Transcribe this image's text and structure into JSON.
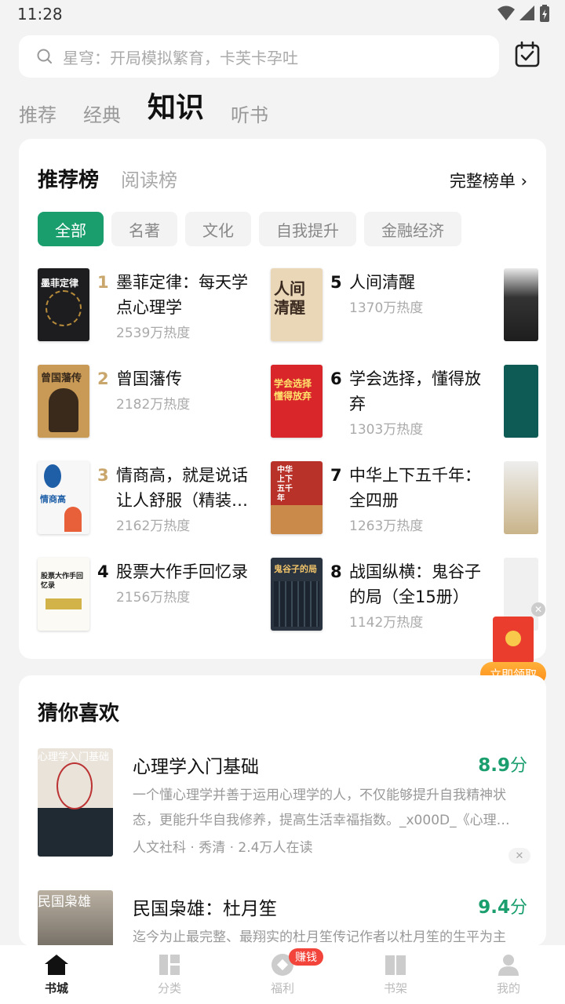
{
  "status": {
    "time": "11:28"
  },
  "search": {
    "placeholder": "星穹：开局模拟繁育，卡芙卡孕吐"
  },
  "tabs": [
    {
      "label": "推荐"
    },
    {
      "label": "经典"
    },
    {
      "label": "知识",
      "active": true
    },
    {
      "label": "听书"
    }
  ],
  "ranking": {
    "title": "推荐榜",
    "alt_title": "阅读榜",
    "full_list_label": "完整榜单",
    "chips": [
      {
        "label": "全部",
        "active": true
      },
      {
        "label": "名著"
      },
      {
        "label": "文化"
      },
      {
        "label": "自我提升"
      },
      {
        "label": "金融经济"
      }
    ],
    "books": [
      {
        "rank": "1",
        "title": "墨菲定律：每天学点心理学",
        "heat": "2539万热度",
        "cover_text": "墨菲定律"
      },
      {
        "rank": "2",
        "title": "曾国藩传",
        "heat": "2182万热度",
        "cover_text": "曾国藩传"
      },
      {
        "rank": "3",
        "title": "情商高，就是说话让人舒服（精装…",
        "heat": "2162万热度",
        "cover_text": "情商高"
      },
      {
        "rank": "4",
        "title": "股票大作手回忆录",
        "heat": "2156万热度",
        "cover_text": "股票大作手回忆录"
      },
      {
        "rank": "5",
        "title": "人间清醒",
        "heat": "1370万热度",
        "cover_text": "人间清醒"
      },
      {
        "rank": "6",
        "title": "学会选择，懂得放弃",
        "heat": "1303万热度",
        "cover_text": "学会选择懂得放弃"
      },
      {
        "rank": "7",
        "title": "中华上下五千年：全四册",
        "heat": "1263万热度",
        "cover_text": "中华上下五千年"
      },
      {
        "rank": "8",
        "title": "战国纵横：鬼谷子的局（全15册）",
        "heat": "1142万热度",
        "cover_text": "鬼谷子的局"
      }
    ]
  },
  "redpacket": {
    "label": "立即领取"
  },
  "guess": {
    "title": "猜你喜欢",
    "items": [
      {
        "name": "心理学入门基础",
        "score": "8.9",
        "score_unit": "分",
        "desc": "一个懂心理学并善于运用心理学的人，不仅能够提升自我精神状态，更能升华自我修养，提高生活幸福指数。_x000D_《心理…",
        "meta": "人文社科 · 秀清 · 2.4万人在读",
        "cover_text": "心理学入门基础"
      },
      {
        "name": "民国枭雄：杜月笙",
        "score": "9.4",
        "score_unit": "分",
        "desc": "迄今为止最完整、最翔实的杜月笙传记作者以杜月笙的生平为主",
        "cover_text": "民国枭雄"
      }
    ]
  },
  "nav": [
    {
      "label": "书城",
      "icon": "home-icon",
      "active": true
    },
    {
      "label": "分类",
      "icon": "grid-icon"
    },
    {
      "label": "福利",
      "icon": "coin-icon",
      "badge": "赚钱"
    },
    {
      "label": "书架",
      "icon": "bookshelf-icon"
    },
    {
      "label": "我的",
      "icon": "user-icon"
    }
  ],
  "colors": {
    "accent": "#1a9e6e",
    "gold_rank": "#c9a66b",
    "badge": "#f2443b"
  }
}
